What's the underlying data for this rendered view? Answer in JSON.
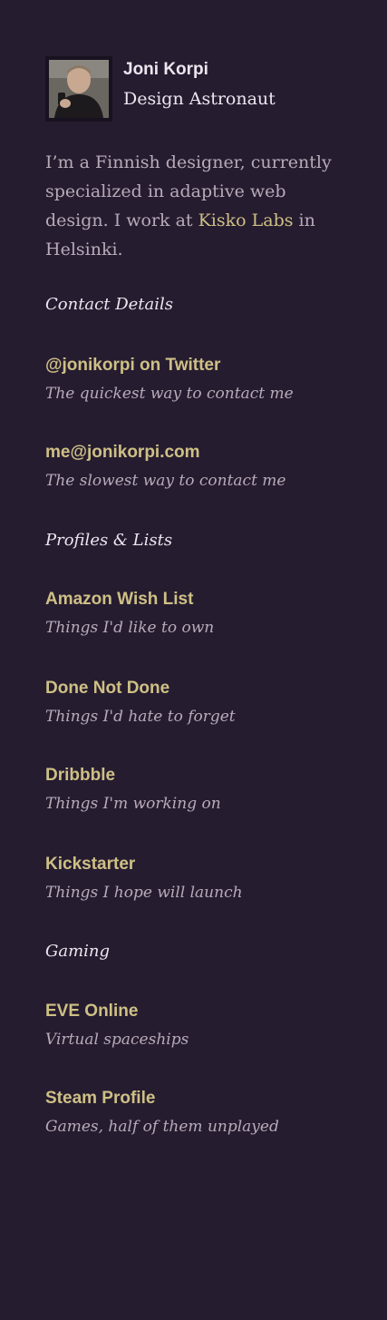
{
  "profile": {
    "name": "Joni Korpi",
    "title": "Design Astronaut"
  },
  "bio": {
    "text_before": "I’m a Finnish designer, currently specialized in adaptive web design. I work at ",
    "link_label": "Kisko Labs",
    "text_after": " in Helsinki."
  },
  "sections": {
    "contact": {
      "heading": "Contact Details",
      "items": [
        {
          "title": "@jonikorpi on Twitter",
          "description": "The quickest way to contact me"
        },
        {
          "title": "me@jonikorpi.com",
          "description": "The slowest way to contact me"
        }
      ]
    },
    "profiles": {
      "heading": "Profiles & Lists",
      "items": [
        {
          "title": "Amazon Wish List",
          "description": "Things I'd like to own"
        },
        {
          "title": "Done Not Done",
          "description": "Things I'd hate to forget"
        },
        {
          "title": "Dribbble",
          "description": "Things I'm working on"
        },
        {
          "title": "Kickstarter",
          "description": "Things I hope will launch"
        }
      ]
    },
    "gaming": {
      "heading": "Gaming",
      "items": [
        {
          "title": "EVE Online",
          "description": "Virtual spaceships"
        },
        {
          "title": "Steam Profile",
          "description": "Games, half of them unplayed"
        }
      ]
    }
  },
  "colors": {
    "background": "#261c30",
    "link": "#cec085",
    "body_text": "#b7abb8",
    "heading_text": "#ece6ee"
  }
}
